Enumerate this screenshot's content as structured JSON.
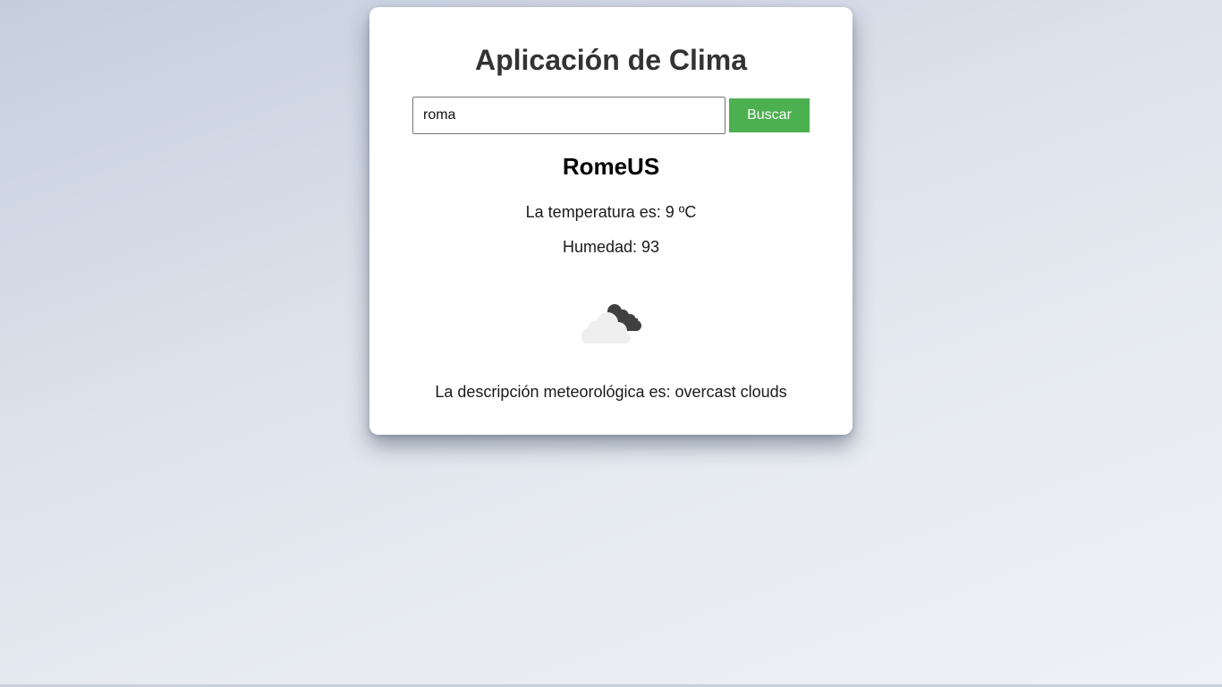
{
  "app": {
    "title": "Aplicación de Clima"
  },
  "search": {
    "value": "roma",
    "button_label": "Buscar"
  },
  "weather": {
    "city": "RomeUS",
    "temperature_label": "La temperatura es: 9 ºC",
    "humidity_label": "Humedad: 93",
    "icon": "overcast-clouds-icon",
    "description_label": "La descripción meteorológica es: overcast clouds"
  },
  "colors": {
    "button": "#4caf50",
    "card": "#ffffff",
    "title": "#333333"
  }
}
